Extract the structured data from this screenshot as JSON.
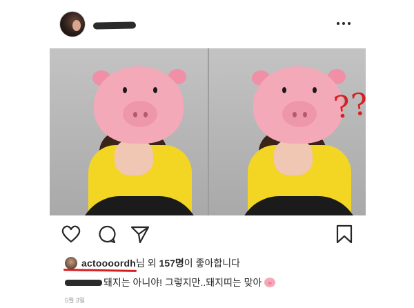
{
  "header": {
    "avatar_icon": "profile-avatar",
    "more_icon": "more-dots-icon"
  },
  "photo": {
    "annotation_text": "??",
    "annotation_color": "#d42020"
  },
  "actions": {
    "icons": [
      "heart-icon",
      "comment-icon",
      "share-icon",
      "bookmark-icon"
    ]
  },
  "likes": {
    "username": "actoooordh",
    "suffix_1": "님 외 ",
    "count": "157명",
    "suffix_2": "이 좋아합니다",
    "underline_color": "#d61e1e"
  },
  "caption": {
    "text": "돼지는 아니야! 그렇지만..돼지띠는 맞아",
    "emoji_icon": "pig-face-icon"
  },
  "post_date": "5월 3일"
}
